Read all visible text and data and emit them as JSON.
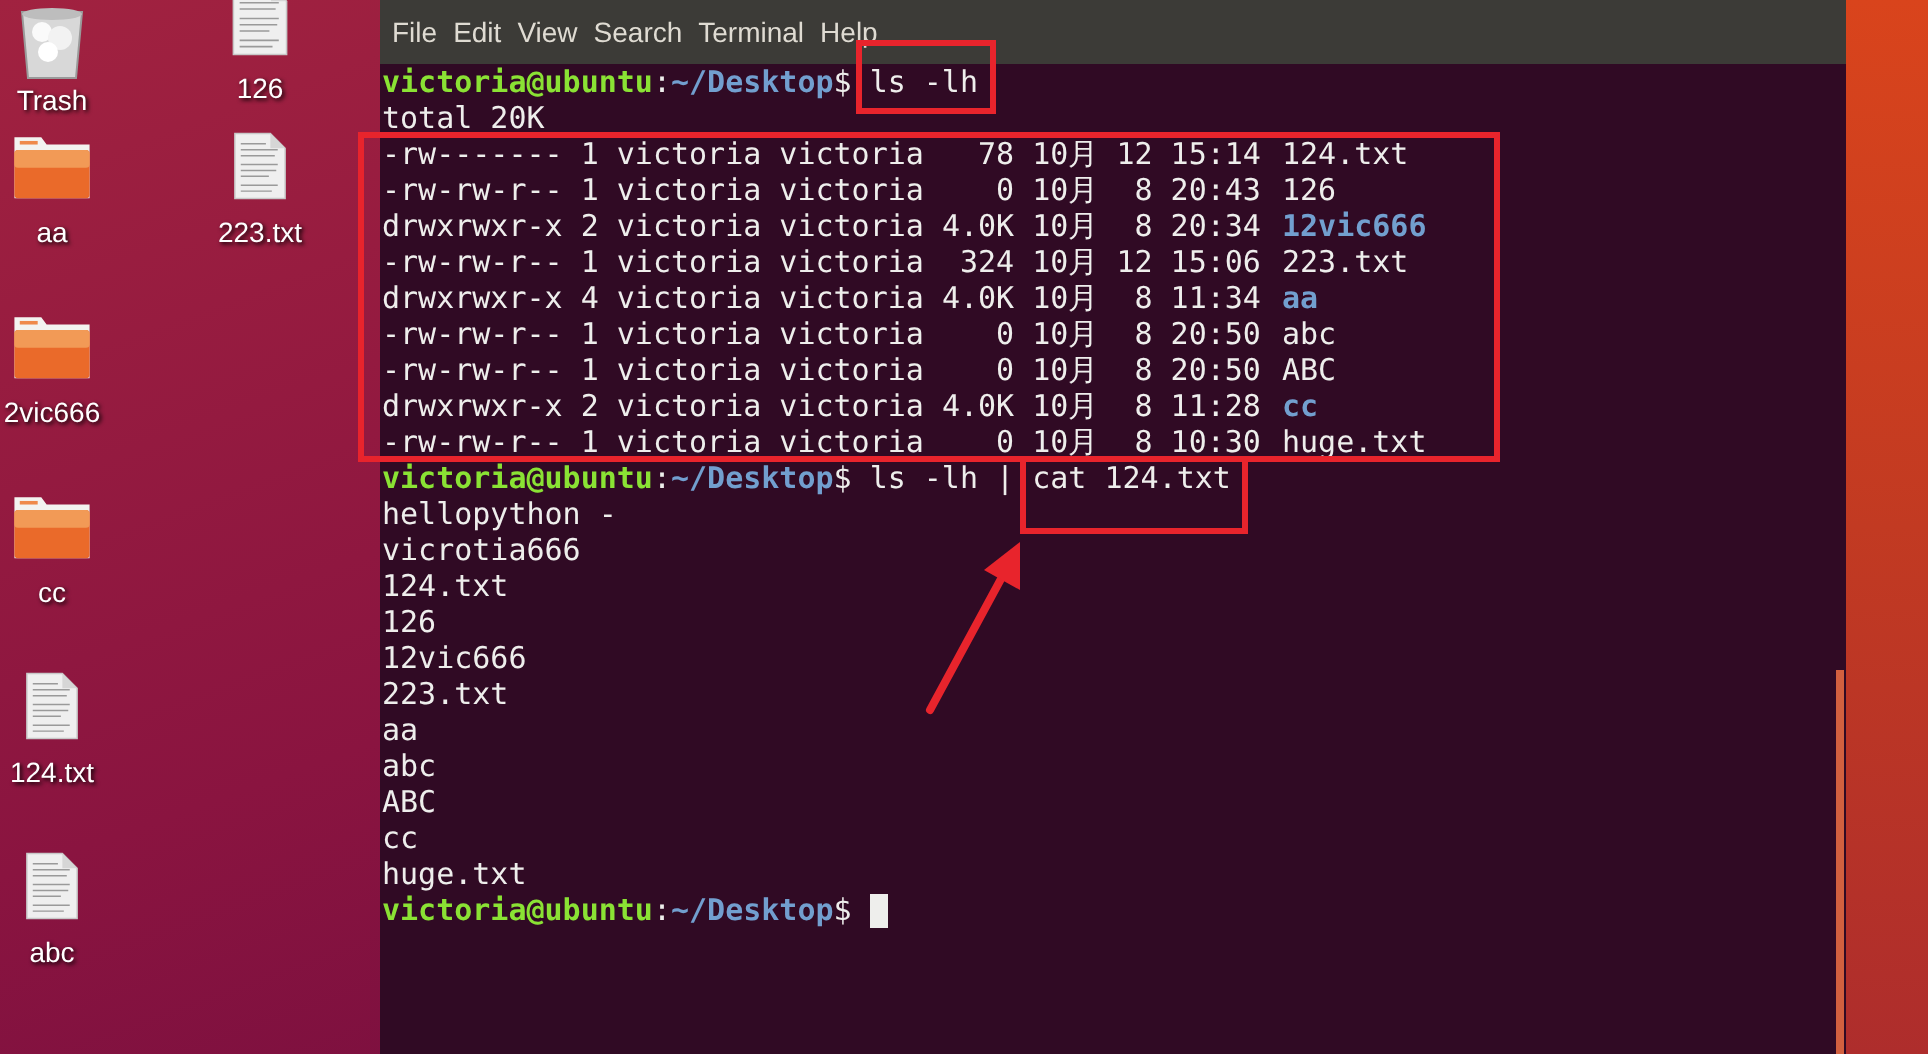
{
  "desktop": {
    "icon_columns": [
      [
        {
          "kind": "trash",
          "label": "Trash"
        },
        {
          "kind": "folder",
          "label": "aa"
        },
        {
          "kind": "folder",
          "label": "2vic666"
        },
        {
          "kind": "folder",
          "label": "cc"
        },
        {
          "kind": "file",
          "label": "124.txt"
        },
        {
          "kind": "file",
          "label": "abc"
        }
      ],
      [
        {
          "kind": "file",
          "label": "126"
        },
        {
          "kind": "file",
          "label": "223.txt"
        }
      ]
    ]
  },
  "terminal": {
    "menu": [
      "File",
      "Edit",
      "View",
      "Search",
      "Terminal",
      "Help"
    ],
    "lines": [
      {
        "kind": "prompt",
        "user": "victoria@ubuntu",
        "colon": ":",
        "path": "~/Desktop",
        "symbol": "$",
        "command": "ls -lh"
      },
      {
        "kind": "output",
        "text": "total 20K"
      },
      {
        "kind": "entry",
        "info": "-rw------- 1 victoria victoria   78 10月 12 15:14",
        "name": "124.txt",
        "dir": false
      },
      {
        "kind": "entry",
        "info": "-rw-rw-r-- 1 victoria victoria    0 10月  8 20:43",
        "name": "126",
        "dir": false
      },
      {
        "kind": "entry",
        "info": "drwxrwxr-x 2 victoria victoria 4.0K 10月  8 20:34",
        "name": "12vic666",
        "dir": true
      },
      {
        "kind": "entry",
        "info": "-rw-rw-r-- 1 victoria victoria  324 10月 12 15:06",
        "name": "223.txt",
        "dir": false
      },
      {
        "kind": "entry",
        "info": "drwxrwxr-x 4 victoria victoria 4.0K 10月  8 11:34",
        "name": "aa",
        "dir": true
      },
      {
        "kind": "entry",
        "info": "-rw-rw-r-- 1 victoria victoria    0 10月  8 20:50",
        "name": "abc",
        "dir": false
      },
      {
        "kind": "entry",
        "info": "-rw-rw-r-- 1 victoria victoria    0 10月  8 20:50",
        "name": "ABC",
        "dir": false
      },
      {
        "kind": "entry",
        "info": "drwxrwxr-x 2 victoria victoria 4.0K 10月  8 11:28",
        "name": "cc",
        "dir": true
      },
      {
        "kind": "entry",
        "info": "-rw-rw-r-- 1 victoria victoria    0 10月  8 10:30",
        "name": "huge.txt",
        "dir": false
      },
      {
        "kind": "prompt",
        "user": "victoria@ubuntu",
        "colon": ":",
        "path": "~/Desktop",
        "symbol": "$",
        "command": "ls -lh | cat 124.txt"
      },
      {
        "kind": "output",
        "text": "hellopython -"
      },
      {
        "kind": "output",
        "text": "vicrotia666"
      },
      {
        "kind": "output",
        "text": "124.txt"
      },
      {
        "kind": "output",
        "text": "126"
      },
      {
        "kind": "output",
        "text": "12vic666"
      },
      {
        "kind": "output",
        "text": "223.txt"
      },
      {
        "kind": "output",
        "text": "aa"
      },
      {
        "kind": "output",
        "text": "abc"
      },
      {
        "kind": "output",
        "text": "ABC"
      },
      {
        "kind": "output",
        "text": "cc"
      },
      {
        "kind": "output",
        "text": "huge.txt"
      },
      {
        "kind": "prompt",
        "user": "victoria@ubuntu",
        "colon": ":",
        "path": "~/Desktop",
        "symbol": "$",
        "cursor": true
      }
    ]
  }
}
